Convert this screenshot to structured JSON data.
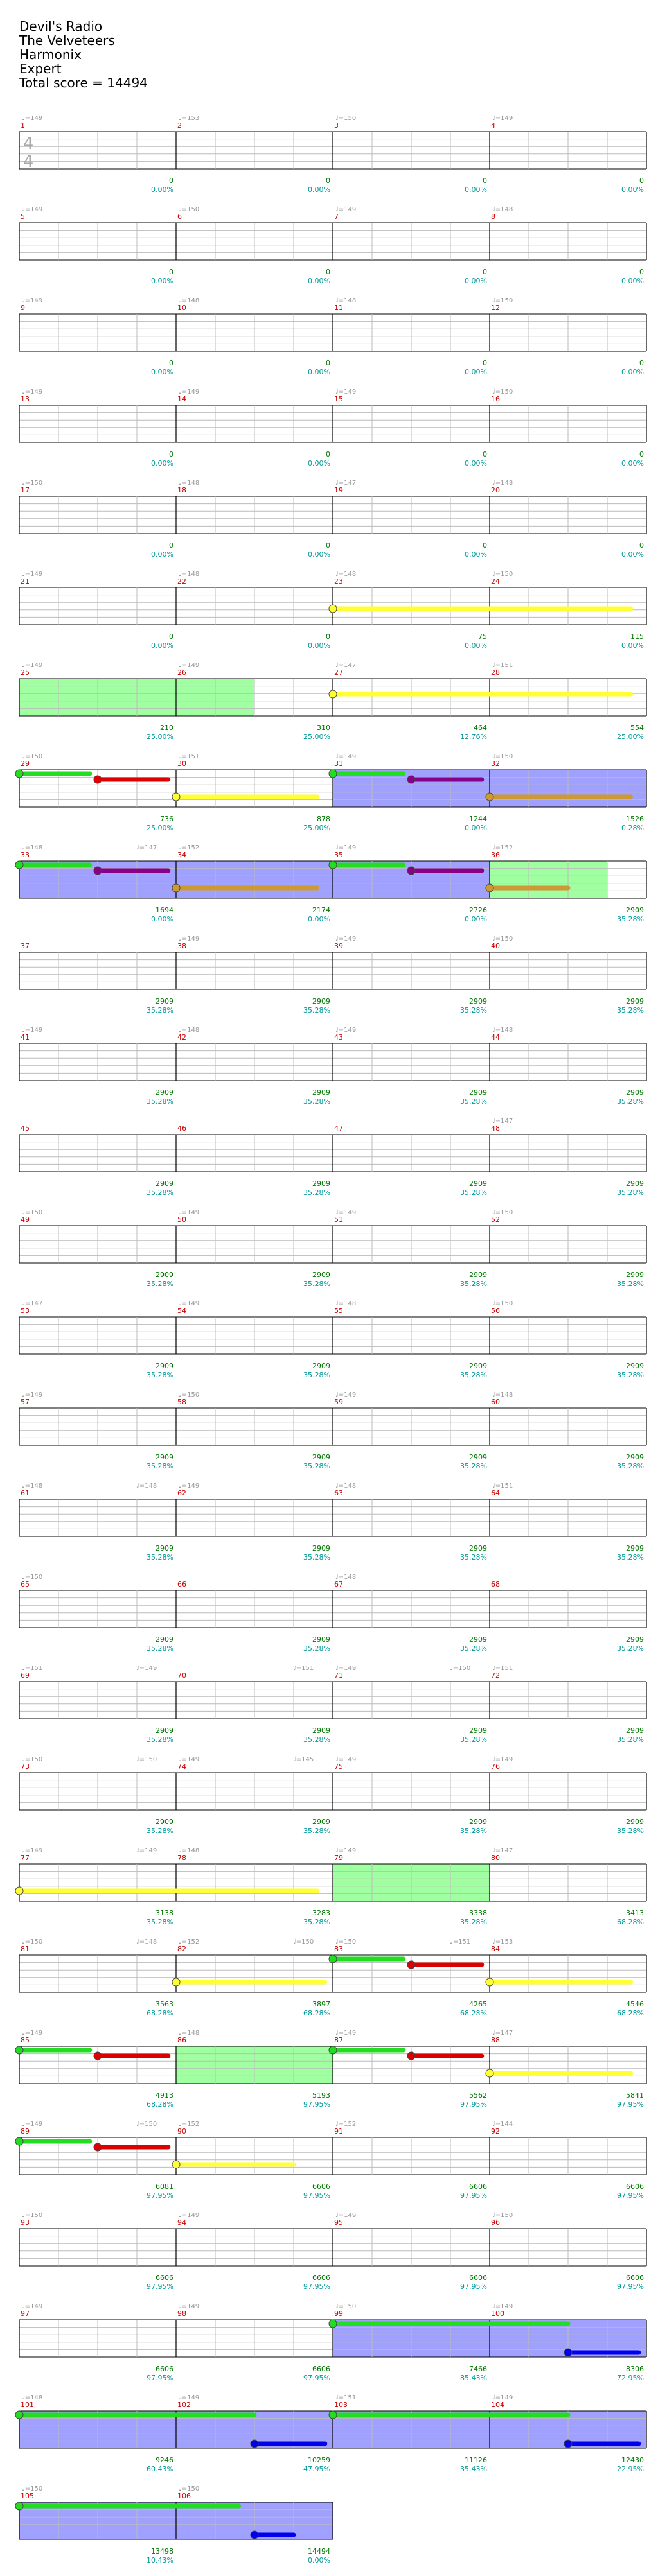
{
  "song": {
    "title": "Devil's Radio",
    "artist": "The Velveteers",
    "game": "Harmonix",
    "difficulty": "Expert",
    "total_score_label": "Total score = 14494"
  },
  "chart_data": {
    "type": "drum-path-chart",
    "time_signature": {
      "top": "4",
      "bottom": "4"
    },
    "colors": {
      "measure_number": "#cc0000",
      "tempo": "#999999",
      "score": "#007700",
      "percent": "#009999",
      "staff_line": "#bbbbbb",
      "yellow_lane": "#ffff33",
      "red_lane": "#dd0000",
      "green_lane": "#22dd22",
      "purple_lane": "#880088",
      "orange_lane": "#cc9933",
      "blue_lane": "#0000ee",
      "overdrive_fill": "#8888ff",
      "activation_fill": "#88ff88"
    },
    "rows": [
      {
        "measures": [
          1,
          2,
          3,
          4
        ],
        "tempos": [
          "♩=149",
          "♩=153",
          "♩=150",
          "♩=149"
        ],
        "scores": [
          "0",
          "0",
          "0",
          "0"
        ],
        "percents": [
          "0.00%",
          "0.00%",
          "0.00%",
          "0.00%"
        ],
        "show_ts": true
      },
      {
        "measures": [
          5,
          6,
          7,
          8
        ],
        "tempos": [
          "♩=149",
          "♩=150",
          "♩=149",
          "♩=148"
        ],
        "scores": [
          "0",
          "0",
          "0",
          "0"
        ],
        "percents": [
          "0.00%",
          "0.00%",
          "0.00%",
          "0.00%"
        ]
      },
      {
        "measures": [
          9,
          10,
          11,
          12
        ],
        "tempos": [
          "♩=149",
          "♩=148",
          "♩=148",
          "♩=150"
        ],
        "scores": [
          "0",
          "0",
          "0",
          "0"
        ],
        "percents": [
          "0.00%",
          "0.00%",
          "0.00%",
          "0.00%"
        ]
      },
      {
        "measures": [
          13,
          14,
          15,
          16
        ],
        "tempos": [
          "♩=149",
          "♩=149",
          "♩=149",
          "♩=150"
        ],
        "scores": [
          "0",
          "0",
          "0",
          "0"
        ],
        "percents": [
          "0.00%",
          "0.00%",
          "0.00%",
          "0.00%"
        ]
      },
      {
        "measures": [
          17,
          18,
          19,
          20
        ],
        "tempos": [
          "♩=150",
          "♩=148",
          "♩=147",
          "♩=148"
        ],
        "scores": [
          "0",
          "0",
          "0",
          "0"
        ],
        "percents": [
          "0.00%",
          "0.00%",
          "0.00%",
          "0.00%"
        ]
      },
      {
        "measures": [
          21,
          22,
          23,
          24
        ],
        "tempos": [
          "♩=149",
          "♩=148",
          "♩=148",
          "♩=150"
        ],
        "scores": [
          "0",
          "0",
          "75",
          "115"
        ],
        "percents": [
          "0.00%",
          "0.00%",
          "0.00%",
          "0.00%"
        ]
      },
      {
        "measures": [
          25,
          26,
          27,
          28
        ],
        "tempos": [
          "♩=149",
          "♩=149",
          "♩=147",
          "♩=151"
        ],
        "scores": [
          "210",
          "310",
          "464",
          "554"
        ],
        "percents": [
          "25.00%",
          "25.00%",
          "12.76%",
          "25.00%"
        ]
      },
      {
        "measures": [
          29,
          30,
          31,
          32
        ],
        "tempos": [
          "♩=150",
          "♩=151",
          "♩=149",
          "♩=150"
        ],
        "scores": [
          "736",
          "878",
          "1244",
          "1526"
        ],
        "percents": [
          "25.00%",
          "25.00%",
          "0.00%",
          "0.28%"
        ]
      },
      {
        "measures": [
          33,
          34,
          35,
          36
        ],
        "tempos": [
          "♩=148",
          "♩=152",
          "♩=149",
          "♩=152",
          "♩=147"
        ],
        "scores": [
          "1694",
          "2174",
          "2726",
          "2909"
        ],
        "percents": [
          "0.00%",
          "0.00%",
          "0.00%",
          "35.28%"
        ]
      },
      {
        "measures": [
          37,
          38,
          39,
          40
        ],
        "tempos": [
          "",
          "♩=149",
          "♩=149",
          "♩=150"
        ],
        "scores": [
          "2909",
          "2909",
          "2909",
          "2909"
        ],
        "percents": [
          "35.28%",
          "35.28%",
          "35.28%",
          "35.28%"
        ]
      },
      {
        "measures": [
          41,
          42,
          43,
          44
        ],
        "tempos": [
          "♩=149",
          "♩=148",
          "♩=149",
          "♩=148"
        ],
        "scores": [
          "2909",
          "2909",
          "2909",
          "2909"
        ],
        "percents": [
          "35.28%",
          "35.28%",
          "35.28%",
          "35.28%"
        ]
      },
      {
        "measures": [
          45,
          46,
          47,
          48
        ],
        "tempos": [
          "",
          "",
          "",
          "♩=147"
        ],
        "scores": [
          "2909",
          "2909",
          "2909",
          "2909"
        ],
        "percents": [
          "35.28%",
          "35.28%",
          "35.28%",
          "35.28%"
        ]
      },
      {
        "measures": [
          49,
          50,
          51,
          52
        ],
        "tempos": [
          "♩=150",
          "♩=149",
          "♩=149",
          "♩=150"
        ],
        "scores": [
          "2909",
          "2909",
          "2909",
          "2909"
        ],
        "percents": [
          "35.28%",
          "35.28%",
          "35.28%",
          "35.28%"
        ]
      },
      {
        "measures": [
          53,
          54,
          55,
          56
        ],
        "tempos": [
          "♩=147",
          "♩=149",
          "♩=148",
          "♩=150"
        ],
        "scores": [
          "2909",
          "2909",
          "2909",
          "2909"
        ],
        "percents": [
          "35.28%",
          "35.28%",
          "35.28%",
          "35.28%"
        ]
      },
      {
        "measures": [
          57,
          58,
          59,
          60
        ],
        "tempos": [
          "♩=149",
          "♩=150",
          "♩=149",
          "♩=148"
        ],
        "scores": [
          "2909",
          "2909",
          "2909",
          "2909"
        ],
        "percents": [
          "35.28%",
          "35.28%",
          "35.28%",
          "35.28%"
        ]
      },
      {
        "measures": [
          61,
          62,
          63,
          64
        ],
        "tempos": [
          "♩=148",
          "♩=149",
          "♩=148",
          "♩=151",
          "♩=148"
        ],
        "scores": [
          "2909",
          "2909",
          "2909",
          "2909"
        ],
        "percents": [
          "35.28%",
          "35.28%",
          "35.28%",
          "35.28%"
        ]
      },
      {
        "measures": [
          65,
          66,
          67,
          68
        ],
        "tempos": [
          "♩=150",
          "",
          "♩=148",
          ""
        ],
        "scores": [
          "2909",
          "2909",
          "2909",
          "2909"
        ],
        "percents": [
          "35.28%",
          "35.28%",
          "35.28%",
          "35.28%"
        ]
      },
      {
        "measures": [
          69,
          70,
          71,
          72
        ],
        "tempos": [
          "♩=151",
          "",
          "♩=149",
          "♩=151",
          "♩=149",
          "♩=151",
          "♩=150"
        ],
        "scores": [
          "2909",
          "2909",
          "2909",
          "2909"
        ],
        "percents": [
          "35.28%",
          "35.28%",
          "35.28%",
          "35.28%"
        ]
      },
      {
        "measures": [
          73,
          74,
          75,
          76
        ],
        "tempos": [
          "♩=150",
          "♩=149",
          "♩=149",
          "♩=149",
          "♩=150",
          "♩=145"
        ],
        "scores": [
          "2909",
          "2909",
          "2909",
          "2909"
        ],
        "percents": [
          "35.28%",
          "35.28%",
          "35.28%",
          "35.28%"
        ]
      },
      {
        "measures": [
          77,
          78,
          79,
          80
        ],
        "tempos": [
          "♩=149",
          "♩=148",
          "♩=149",
          "♩=147",
          "♩=149"
        ],
        "scores": [
          "3138",
          "3283",
          "3338",
          "3413"
        ],
        "percents": [
          "35.28%",
          "35.28%",
          "35.28%",
          "68.28%"
        ]
      },
      {
        "measures": [
          81,
          82,
          83,
          84
        ],
        "tempos": [
          "♩=150",
          "♩=152",
          "♩=150",
          "♩=153",
          "♩=148",
          "♩=150",
          "♩=151"
        ],
        "scores": [
          "3563",
          "3897",
          "4265",
          "4546"
        ],
        "percents": [
          "68.28%",
          "68.28%",
          "68.28%",
          "68.28%"
        ]
      },
      {
        "measures": [
          85,
          86,
          87,
          88
        ],
        "tempos": [
          "♩=149",
          "♩=148",
          "♩=149",
          "♩=147"
        ],
        "scores": [
          "4913",
          "5193",
          "5562",
          "5841"
        ],
        "percents": [
          "68.28%",
          "97.95%",
          "97.95%",
          "97.95%"
        ]
      },
      {
        "measures": [
          89,
          90,
          91,
          92
        ],
        "tempos": [
          "♩=149",
          "♩=152",
          "♩=152",
          "♩=144",
          "♩=150"
        ],
        "scores": [
          "6081",
          "6606",
          "6606",
          "6606"
        ],
        "percents": [
          "97.95%",
          "97.95%",
          "97.95%",
          "97.95%"
        ]
      },
      {
        "measures": [
          93,
          94,
          95,
          96
        ],
        "tempos": [
          "♩=150",
          "♩=149",
          "♩=149",
          "♩=150"
        ],
        "scores": [
          "6606",
          "6606",
          "6606",
          "6606"
        ],
        "percents": [
          "97.95%",
          "97.95%",
          "97.95%",
          "97.95%"
        ]
      },
      {
        "measures": [
          97,
          98,
          99,
          100
        ],
        "tempos": [
          "♩=149",
          "♩=149",
          "♩=150",
          "♩=149"
        ],
        "scores": [
          "6606",
          "6606",
          "7466",
          "8306"
        ],
        "percents": [
          "97.95%",
          "97.95%",
          "85.43%",
          "72.95%"
        ]
      },
      {
        "measures": [
          101,
          102,
          103,
          104
        ],
        "tempos": [
          "♩=148",
          "♩=149",
          "♩=151",
          "♩=149"
        ],
        "scores": [
          "9246",
          "10259",
          "11126",
          "12430"
        ],
        "percents": [
          "60.43%",
          "47.95%",
          "35.43%",
          "22.95%"
        ]
      },
      {
        "measures": [
          105,
          106
        ],
        "tempos": [
          "♩=150",
          "♩=150"
        ],
        "scores": [
          "13498",
          "14494"
        ],
        "percents": [
          "10.43%",
          "0.00%"
        ]
      }
    ]
  }
}
